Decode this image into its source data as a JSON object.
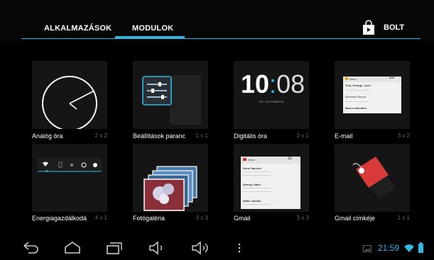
{
  "tabs": {
    "apps_label": "ALKALMAZÁSOK",
    "widgets_label": "MODULOK",
    "store_label": "BOLT"
  },
  "widgets": [
    {
      "name": "Analóg óra",
      "size": "2 x 2"
    },
    {
      "name": "Beállítások paranc",
      "size": "1 x 1"
    },
    {
      "name": "Digitális óra",
      "size": "2 x 1"
    },
    {
      "name": "E-mail",
      "size": "3 x 2"
    },
    {
      "name": "Energiagazdálkodá",
      "size": "4 x 1"
    },
    {
      "name": "Fotógaléria",
      "size": "3 x 3"
    },
    {
      "name": "Gmail",
      "size": "3 x 3"
    },
    {
      "name": "Gmail címkéje",
      "size": "1 x 1"
    }
  ],
  "previews": {
    "digital_time_hours": "10",
    "digital_time_minutes": "08",
    "digital_date": "PÉ., OCTOBER 05",
    "email_header": "Inbox",
    "email_count": "16",
    "email_rows": [
      "Tom, George, Leen",
      "Business Report",
      "Marco Gasoline"
    ],
    "gmail_header": "Inbox",
    "gmail_count": "15",
    "gmail_rows": [
      "Anne Spector",
      "Wendy, Gabe",
      "Willie Jacobs"
    ]
  },
  "status": {
    "time": "21:59"
  },
  "colors": {
    "accent": "#33b5e5",
    "label_red": "#d83a3a"
  }
}
